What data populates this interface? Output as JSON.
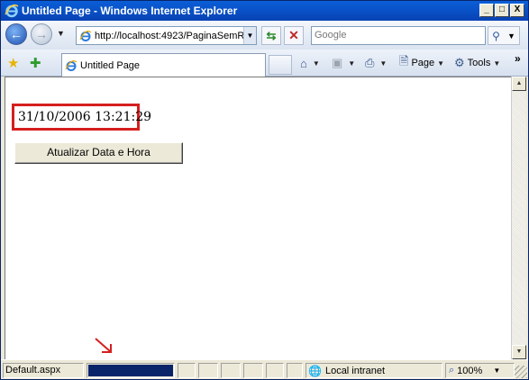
{
  "window": {
    "title": "Untitled Page - Windows Internet Explorer",
    "min_label": "_",
    "max_label": "□",
    "close_label": "X"
  },
  "addressbar": {
    "url": "http://localhost:4923/PaginaSemR",
    "dropdown_icon": "chevron-down-icon",
    "search_placeholder": "Google"
  },
  "toolbar": {
    "tab_label": "Untitled Page",
    "page_label": "Page",
    "tools_label": "Tools",
    "more_label": "»"
  },
  "content": {
    "datetime": "31/10/2006 13:21:29",
    "update_button_label": "Atualizar Data e Hora",
    "highlight_color": "#d51f1f"
  },
  "statusbar": {
    "status_text": "Default.aspx",
    "progress": 1.0,
    "zone_label": "Local intranet",
    "zoom_label": "100%"
  }
}
